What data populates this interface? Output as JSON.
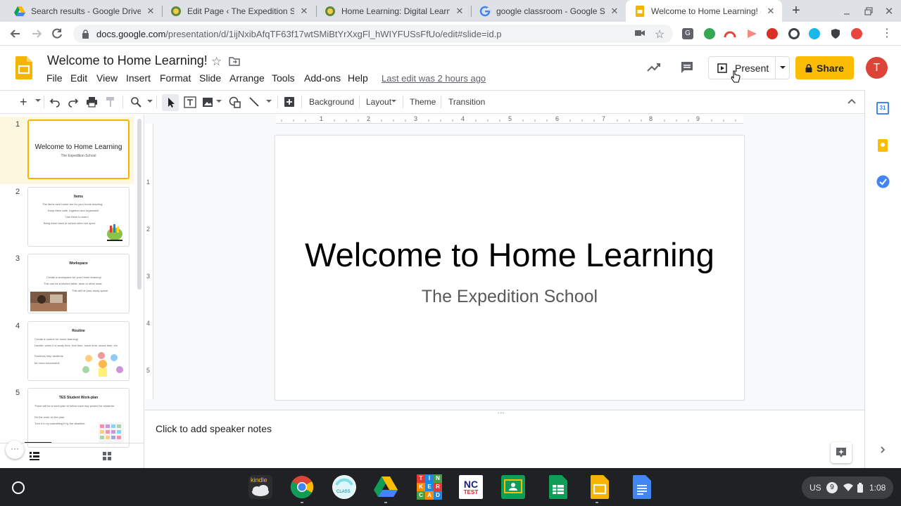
{
  "browser": {
    "tabs": [
      {
        "title": "Search results - Google Drive",
        "icon": "google-drive-icon"
      },
      {
        "title": "Edit Page ‹ The Expedition Scho",
        "icon": "school-seal-icon"
      },
      {
        "title": "Home Learning: Digital Learning",
        "icon": "school-seal-icon"
      },
      {
        "title": "google classroom - Google Sear",
        "icon": "google-g-icon"
      },
      {
        "title": "Welcome to Home Learning! - G",
        "icon": "slides-icon",
        "active": true
      }
    ],
    "url_host": "docs.google.com",
    "url_path": "/presentation/d/1ijNxibAfqTF63f17wtSMiBtYrXxgFl_hWIYFUSsFfUo/edit#slide=id.p"
  },
  "doc": {
    "title": "Welcome to Home Learning!",
    "menus": [
      "File",
      "Edit",
      "View",
      "Insert",
      "Format",
      "Slide",
      "Arrange",
      "Tools",
      "Add-ons",
      "Help"
    ],
    "last_edit": "Last edit was 2 hours ago",
    "present_label": "Present",
    "share_label": "Share",
    "avatar_initial": "T"
  },
  "toolbar": {
    "background": "Background",
    "layout": "Layout",
    "theme": "Theme",
    "transition": "Transition"
  },
  "ruler": {
    "h_labels": [
      "1",
      "2",
      "3",
      "4",
      "5",
      "6",
      "7",
      "8",
      "9"
    ],
    "v_labels": [
      "1",
      "2",
      "3",
      "4",
      "5"
    ]
  },
  "slides": [
    {
      "number": "1",
      "title": "Welcome to Home Learning",
      "subtitle": "The Expedition School"
    },
    {
      "number": "2",
      "title": "Items",
      "lines": [
        "The items sent home are for your home learning.",
        "Keep them safe, together and organized!",
        "Use them to learn!",
        "Bring them back to school when we open."
      ]
    },
    {
      "number": "3",
      "title": "Workspace",
      "lines": [
        "Create a workspace for your home learning!",
        "This can be a kitchen table, desk or other area.",
        "This will be your study space."
      ]
    },
    {
      "number": "4",
      "title": "Routine",
      "lines": [
        "Create a routine for home learning!",
        "Decide: when it is study time, free time, lunch time, snack time, etc.",
        "Routines help students",
        "be more successful!"
      ]
    },
    {
      "number": "5",
      "title": "TES Student Work-plan",
      "lines": [
        "There will be a work-plan to follow each day posted for students.",
        "Do the work on the plan.",
        "Turn it in by submitting it by the deadline."
      ]
    }
  ],
  "current_slide": {
    "title": "Welcome to Home Learning",
    "subtitle": "The Expedition School"
  },
  "notes_placeholder": "Click to add speaker notes",
  "shelf": {
    "apps": [
      "Kindle",
      "Chrome",
      "Class",
      "Google Drive",
      "Tinkercad",
      "NC Test",
      "Google Classroom",
      "Google Sheets",
      "Google Slides",
      "Google Docs"
    ],
    "kindle_label": "kindle",
    "class_label": "CLASS",
    "tinkercad_letters": [
      "T",
      "I",
      "N",
      "K",
      "E",
      "R",
      "C",
      "A",
      "D"
    ],
    "nctest_top": "NC",
    "nctest_bottom": "TEST",
    "locale": "US",
    "notif_count": "9",
    "time": "1:08"
  },
  "colors": {
    "slides_yellow": "#f4b400",
    "share_yellow": "#fbbc04",
    "avatar_red": "#db4437",
    "shelf_bg": "#202124"
  }
}
